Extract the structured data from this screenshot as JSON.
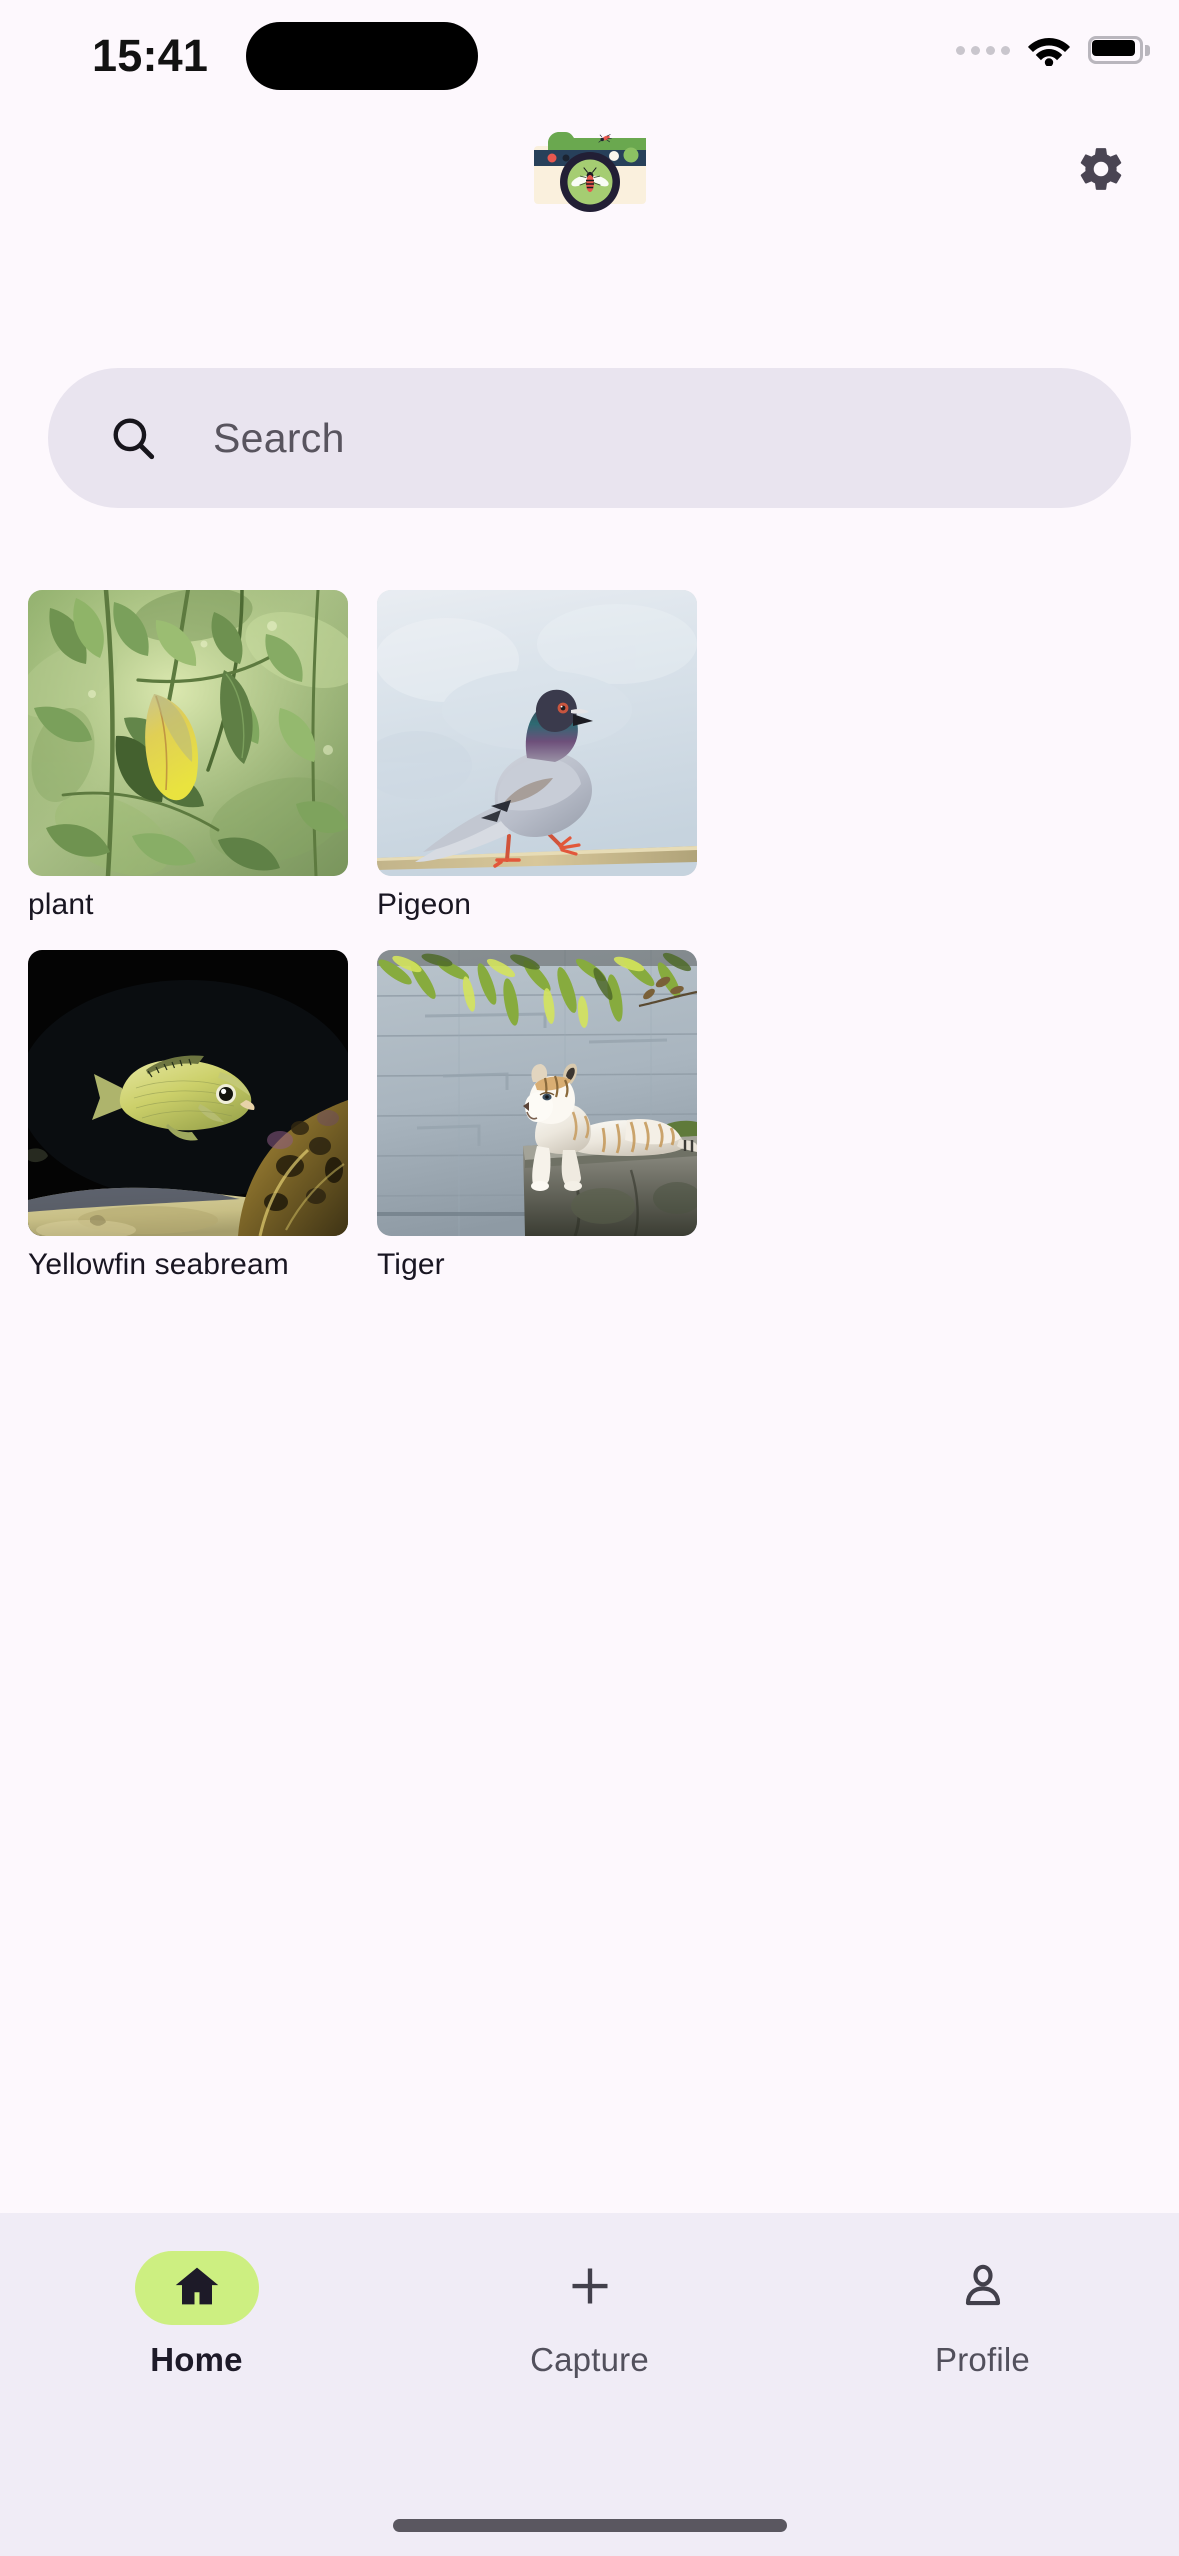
{
  "status_bar": {
    "time": "15:41",
    "cellular_icon": "cellular-dots-icon",
    "wifi_icon": "wifi-icon",
    "battery_icon": "battery-full-icon"
  },
  "header": {
    "logo_icon": "camera-bee-logo",
    "settings_icon": "gear-icon"
  },
  "search": {
    "icon": "search-icon",
    "placeholder": "Search",
    "value": ""
  },
  "gallery": {
    "items": [
      {
        "label": "plant",
        "image": "plant-leaves-photo"
      },
      {
        "label": "Pigeon",
        "image": "pigeon-photo"
      },
      {
        "label": "Yellowfin seabream",
        "image": "yellowfin-seabream-photo"
      },
      {
        "label": "Tiger",
        "image": "tiger-photo"
      }
    ]
  },
  "tabbar": {
    "items": [
      {
        "label": "Home",
        "icon": "home-icon",
        "active": true
      },
      {
        "label": "Capture",
        "icon": "plus-icon",
        "active": false
      },
      {
        "label": "Profile",
        "icon": "person-icon",
        "active": false
      }
    ]
  },
  "colors": {
    "page_background": "#fdf8fd",
    "tabbar_background": "#f0ecf6",
    "search_background": "#e9e4ef",
    "accent_green": "#cdef81",
    "text_primary": "#191622",
    "text_secondary": "#52505c",
    "logo_green": "#6aa84f",
    "logo_navy": "#27405a",
    "logo_cream": "#faf0dd"
  }
}
